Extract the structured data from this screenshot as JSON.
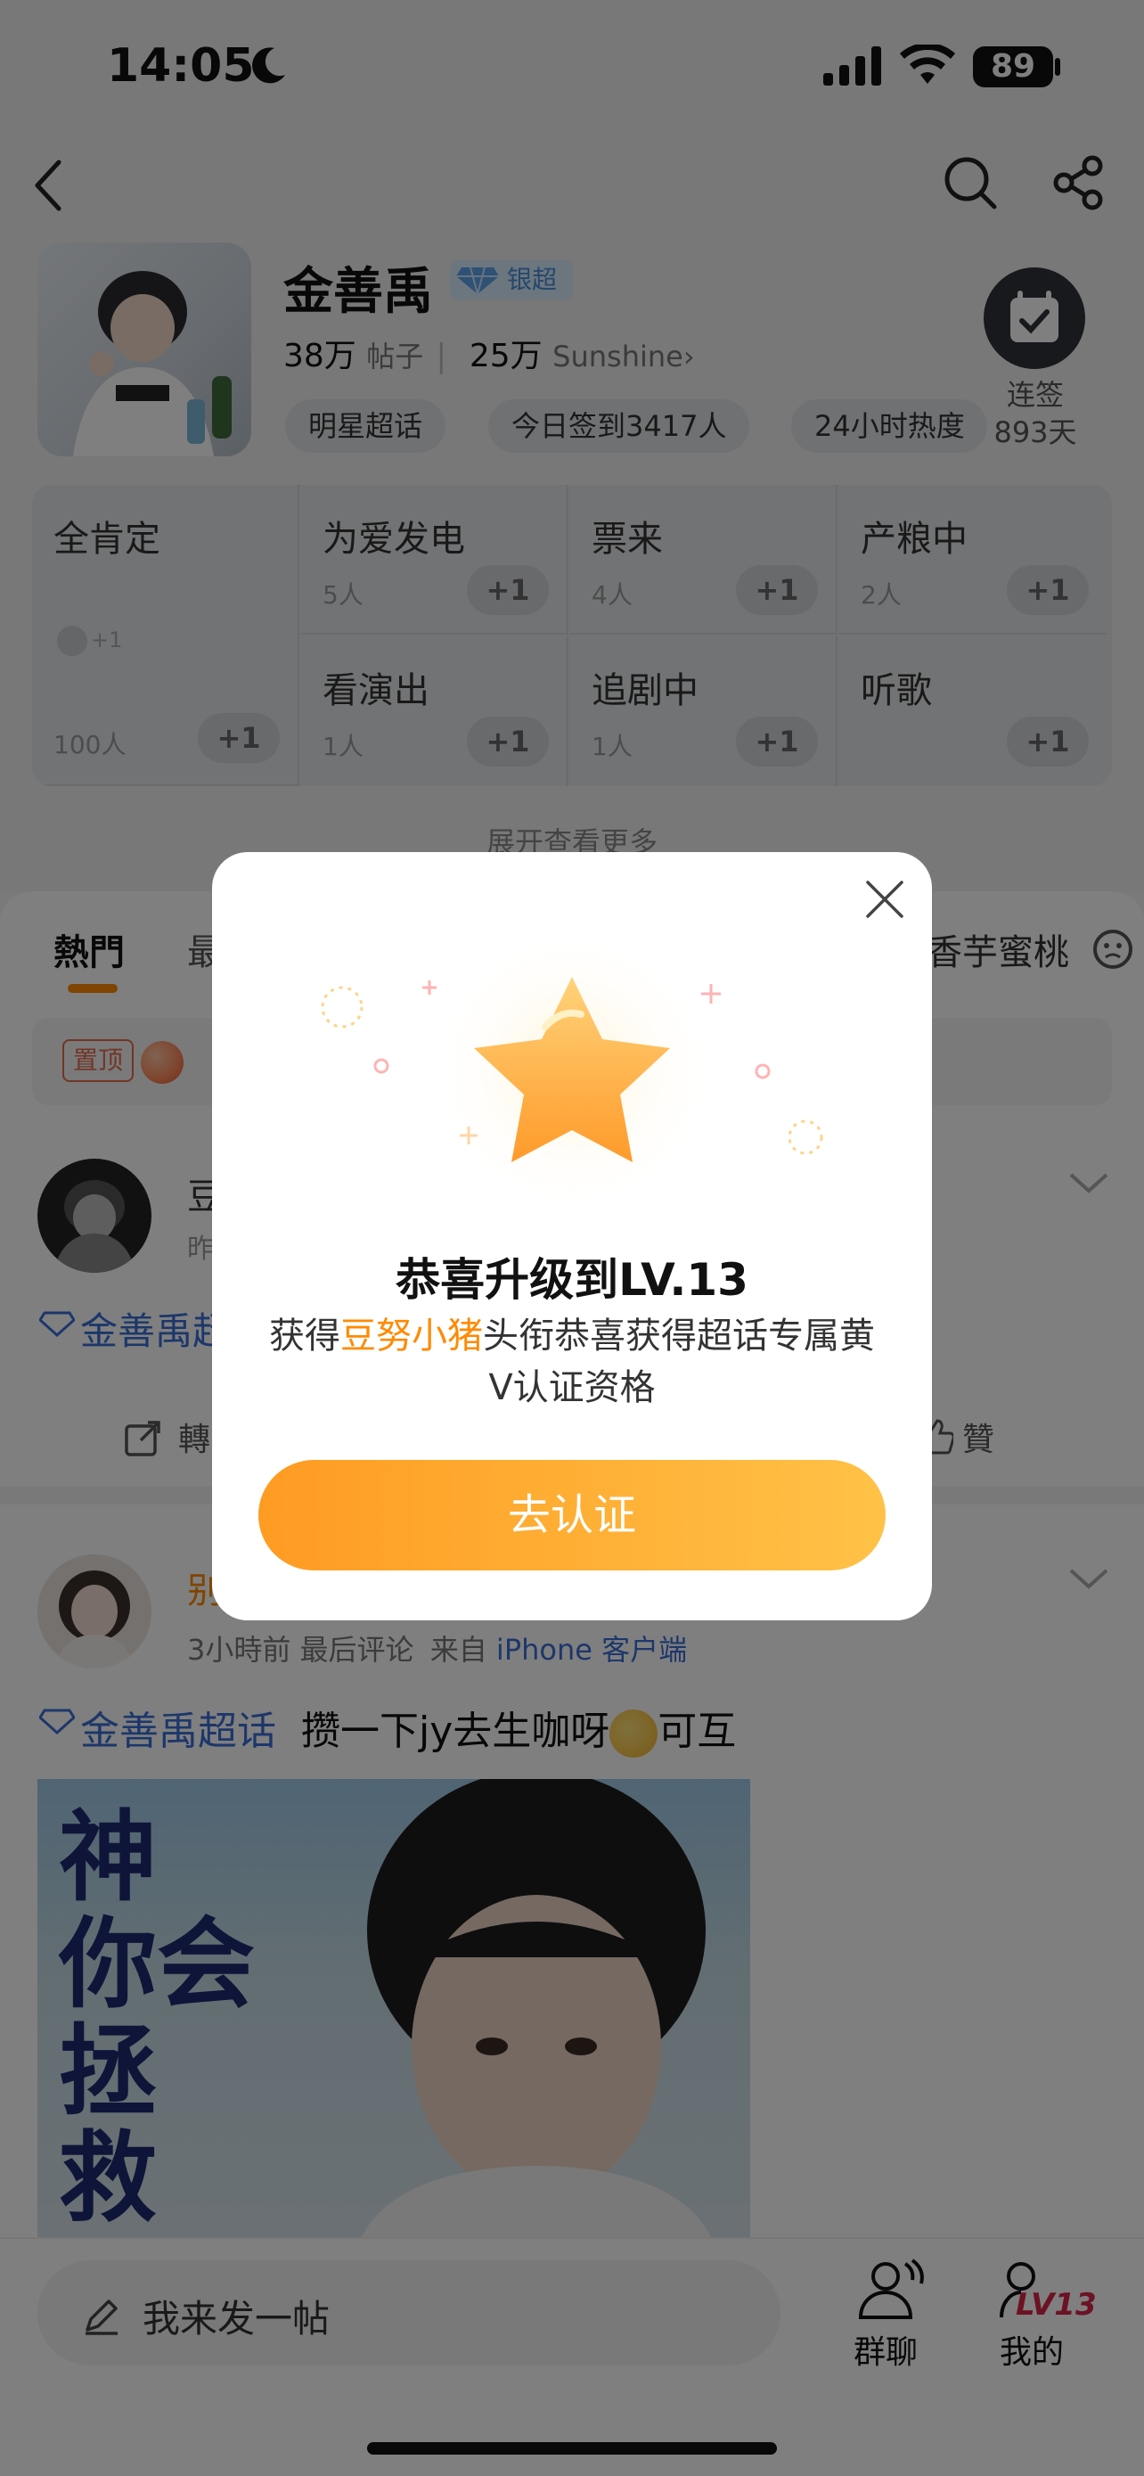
{
  "status_bar": {
    "time": "14:05",
    "battery": "89"
  },
  "topic": {
    "name": "金善禹",
    "badge": "银超",
    "posts_count": "38万",
    "posts_unit": "帖子",
    "fans_count": "25万",
    "fans_name": "Sunshine",
    "chips": [
      "明星超话",
      "今日签到3417人",
      "24小时热度"
    ],
    "checkin_label": "连签",
    "checkin_days": "893天"
  },
  "grid": {
    "cells": [
      {
        "title": "全肯定",
        "sub": "100人",
        "plus": "+1"
      },
      {
        "title": "为爱发电",
        "sub": "5人",
        "plus": "+1"
      },
      {
        "title": "票来",
        "sub": "4人",
        "plus": "+1"
      },
      {
        "title": "产粮中",
        "sub": "2人",
        "plus": "+1"
      },
      {
        "title": "看演出",
        "sub": "1人",
        "plus": "+1"
      },
      {
        "title": "追剧中",
        "sub": "1人",
        "plus": "+1"
      },
      {
        "title": "听歌",
        "sub": "",
        "plus": "+1"
      }
    ],
    "mini_plus": "+1",
    "expand": "展开查看更多"
  },
  "tabs": {
    "hot": "熱門",
    "latest": "最",
    "right": "香芋蜜桃"
  },
  "pinned": {
    "tag": "置顶"
  },
  "post1": {
    "name": "豆",
    "time": "昨",
    "topic_text": "金善禹超"
  },
  "actions": {
    "repost": "轉",
    "like": "贊"
  },
  "post2": {
    "name": "别",
    "time": "3小時前",
    "last_comment": "最后评论",
    "from_label": "来自",
    "source": "iPhone 客户端",
    "topic": "金善禹超话",
    "text_before": "攒一下jy去生咖呀",
    "text_after": "可互",
    "image_text": [
      "神",
      "你会",
      "拯",
      "救"
    ]
  },
  "bottom": {
    "compose": "我来发一帖",
    "group_chat": "群聊",
    "mine": "我的",
    "level": "LV13"
  },
  "modal": {
    "title": "恭喜升级到LV.13",
    "desc_prefix": "获得",
    "desc_highlight": "豆努小猪",
    "desc_suffix": "头衔恭喜获得超话专属黄V认证资格",
    "button": "去认证"
  },
  "colors": {
    "accent": "#ff8a00",
    "link": "#3b6fd6",
    "badge": "#4a8fd6"
  }
}
